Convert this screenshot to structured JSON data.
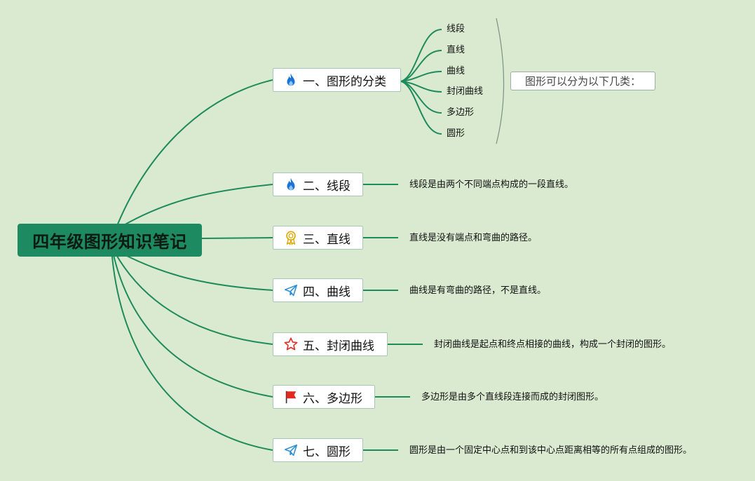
{
  "colors": {
    "background": "#d9ead0",
    "root_fill": "#1e8a62",
    "branch_line": "#1f8a5c",
    "node_border": "#a8c8b6"
  },
  "root": {
    "label": "四年级图形知识笔记"
  },
  "topics": [
    {
      "label": "一、图形的分类",
      "icon": "flame-icon",
      "subtopics": [
        "线段",
        "直线",
        "曲线",
        "封闭曲线",
        "多边形",
        "圆形"
      ],
      "summary": "图形可以分为以下几类："
    },
    {
      "label": "二、线段",
      "icon": "flame-icon",
      "note": "线段是由两个不同端点构成的一段直线。"
    },
    {
      "label": "三、直线",
      "icon": "award-medal-icon",
      "note": "直线是没有端点和弯曲的路径。"
    },
    {
      "label": "四、曲线",
      "icon": "paper-plane-icon",
      "note": "曲线是有弯曲的路径，不是直线。"
    },
    {
      "label": "五、封闭曲线",
      "icon": "star-icon",
      "note": "封闭曲线是起点和终点相接的曲线，构成一个封闭的图形。"
    },
    {
      "label": "六、多边形",
      "icon": "red-flag-icon",
      "note": "多边形是由多个直线段连接而成的封闭图形。"
    },
    {
      "label": "七、圆形",
      "icon": "paper-plane-icon",
      "note": "圆形是由一个固定中心点和到该中心点距离相等的所有点组成的图形。"
    }
  ]
}
